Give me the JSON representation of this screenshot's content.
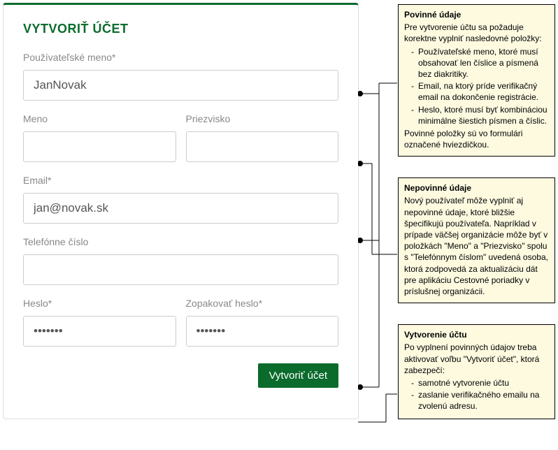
{
  "form": {
    "title": "VYTVORIŤ ÚČET",
    "username": {
      "label": "Používateľské meno*",
      "value": "JanNovak"
    },
    "firstname": {
      "label": "Meno",
      "value": ""
    },
    "lastname": {
      "label": "Priezvisko",
      "value": ""
    },
    "email": {
      "label": "Email*",
      "value": "jan@novak.sk"
    },
    "phone": {
      "label": "Telefónne číslo",
      "value": ""
    },
    "password": {
      "label": "Heslo*",
      "value": "•••••••"
    },
    "password2": {
      "label": "Zopakovať heslo*",
      "value": "•••••••"
    },
    "submit": "Vytvoriť účet"
  },
  "notes": {
    "n1": {
      "title": "Povinné údaje",
      "intro": "Pre vytvorenie účtu sa požaduje korektne vyplniť nasledovné položky:",
      "b1": "Používateľské meno, ktoré musí obsahovať len číslice a písmená bez diakritiky.",
      "b2": "Email, na ktorý príde verifikačný email na dokončenie registrácie.",
      "b3": "Heslo, ktoré musí byť kombináciou minimálne šiestich písmen a číslic.",
      "outro": "Povinné položky sú vo formulári označené hviezdičkou."
    },
    "n2": {
      "title": "Nepovinné údaje",
      "body": "Nový používateľ môže vyplniť aj nepovinné údaje, ktoré bližšie špecifikujú používateľa. Napríklad v prípade väčšej organizácie môže byť v položkách \"Meno\" a \"Priezvisko\" spolu s \"Telefónnym číslom\" uvedená osoba, ktorá zodpovedá za aktualizáciu dát pre aplikáciu Cestovné poriadky v príslušnej organizácii."
    },
    "n3": {
      "title": "Vytvorenie účtu",
      "intro": "Po vyplnení povinných údajov treba aktivovať voľbu \"Vytvoriť účet\", ktorá zabezpečí:",
      "b1": "samotné vytvorenie účtu",
      "b2": "zaslanie verifikačného emailu na zvolenú adresu."
    }
  }
}
